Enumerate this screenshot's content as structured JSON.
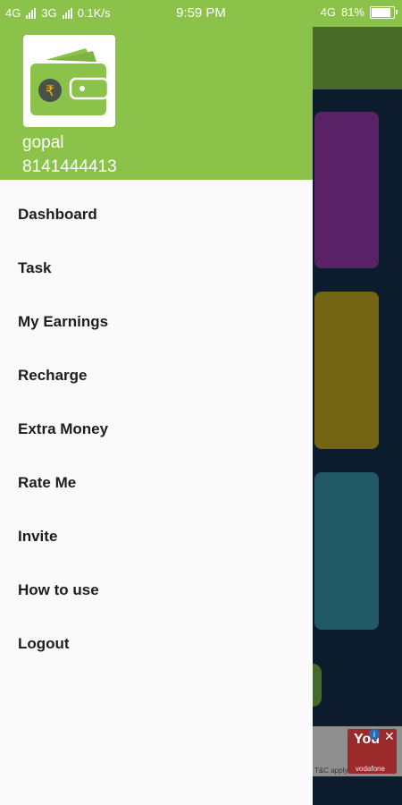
{
  "status_bar": {
    "network1": "4G",
    "network2": "3G",
    "speed": "0.1K/s",
    "time": "9:59 PM",
    "right_network": "4G",
    "battery": "81%"
  },
  "drawer": {
    "user_name": "gopal",
    "user_phone": "8141444413",
    "items": [
      {
        "label": "Dashboard"
      },
      {
        "label": "Task"
      },
      {
        "label": "My Earnings"
      },
      {
        "label": "Recharge"
      },
      {
        "label": "Extra Money"
      },
      {
        "label": "Rate Me"
      },
      {
        "label": "Invite"
      },
      {
        "label": "How to use"
      },
      {
        "label": "Logout"
      }
    ]
  },
  "ad": {
    "title": "You",
    "text": "T&C apply",
    "brand": "vodafone"
  },
  "colors": {
    "accent": "#8bc34a",
    "drawer_bg": "#fafafa"
  }
}
